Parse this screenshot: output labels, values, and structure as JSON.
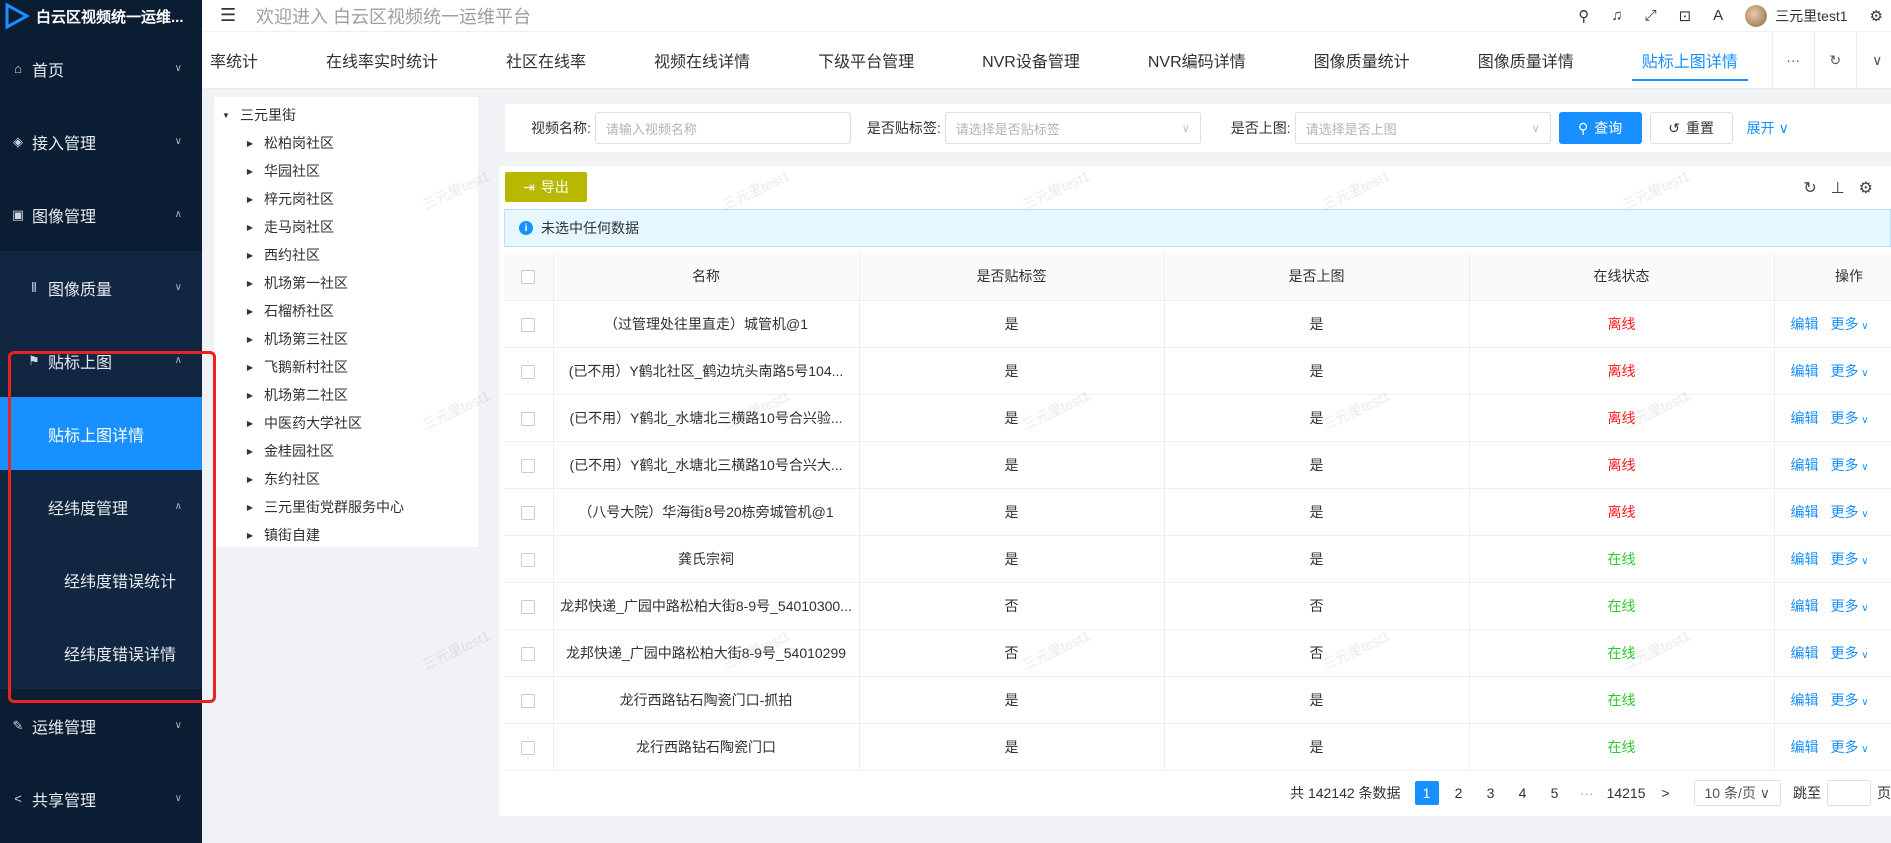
{
  "app": {
    "title": "白云区视频统一运维...",
    "welcome": "欢迎进入 白云区视频统一运维平台",
    "user": "三元里test1",
    "watermark": "三元里test1"
  },
  "sidebar": {
    "items": [
      {
        "label": "首页",
        "icon": "home-icon"
      },
      {
        "label": "接入管理",
        "icon": "shield-icon"
      },
      {
        "label": "图像管理",
        "icon": "image-icon"
      },
      {
        "label": "图像质量",
        "icon": "barcode-icon"
      },
      {
        "label": "贴标上图",
        "icon": "map-pin-icon"
      },
      {
        "label": "贴标上图详情"
      },
      {
        "label": "经纬度管理"
      },
      {
        "label": "经纬度错误统计"
      },
      {
        "label": "经纬度错误详情"
      },
      {
        "label": "运维管理",
        "icon": "wrench-icon"
      },
      {
        "label": "共享管理",
        "icon": "share-icon"
      }
    ]
  },
  "tabs": [
    "率统计",
    "在线率实时统计",
    "社区在线率",
    "视频在线详情",
    "下级平台管理",
    "NVR设备管理",
    "NVR编码详情",
    "图像质量统计",
    "图像质量详情",
    "贴标上图详情"
  ],
  "tab_more": "···",
  "tree": {
    "root": "三元里街",
    "children": [
      "松柏岗社区",
      "华园社区",
      "梓元岗社区",
      "走马岗社区",
      "西约社区",
      "机场第一社区",
      "石榴桥社区",
      "机场第三社区",
      "飞鹅新村社区",
      "机场第二社区",
      "中医药大学社区",
      "金桂园社区",
      "东约社区",
      "三元里街党群服务中心",
      "镇街自建"
    ]
  },
  "search": {
    "name_label": "视频名称:",
    "name_placeholder": "请输入视频名称",
    "tag_label": "是否贴标签:",
    "tag_placeholder": "请选择是否贴标签",
    "map_label": "是否上图:",
    "map_placeholder": "请选择是否上图",
    "query": "查询",
    "reset": "重置",
    "expand": "展开"
  },
  "toolbar": {
    "export": "导出",
    "info": "未选中任何数据"
  },
  "table": {
    "headers": [
      "名称",
      "是否贴标签",
      "是否上图",
      "在线状态",
      "操作"
    ],
    "rows": [
      {
        "name": "（过管理处往里直走）城管机@1",
        "tag": "是",
        "map": "是",
        "status": "离线",
        "online": false
      },
      {
        "name": "(已不用）Y鹤北社区_鹤边坑头南路5号104...",
        "tag": "是",
        "map": "是",
        "status": "离线",
        "online": false
      },
      {
        "name": "(已不用）Y鹤北_水塘北三横路10号合兴验...",
        "tag": "是",
        "map": "是",
        "status": "离线",
        "online": false
      },
      {
        "name": "(已不用）Y鹤北_水塘北三横路10号合兴大...",
        "tag": "是",
        "map": "是",
        "status": "离线",
        "online": false
      },
      {
        "name": "（八号大院）华海街8号20栋旁城管机@1",
        "tag": "是",
        "map": "是",
        "status": "离线",
        "online": false
      },
      {
        "name": "龚氏宗祠",
        "tag": "是",
        "map": "是",
        "status": "在线",
        "online": true
      },
      {
        "name": "龙邦快递_广园中路松柏大街8-9号_54010300...",
        "tag": "否",
        "map": "否",
        "status": "在线",
        "online": true
      },
      {
        "name": "龙邦快递_广园中路松柏大街8-9号_54010299",
        "tag": "否",
        "map": "否",
        "status": "在线",
        "online": true
      },
      {
        "name": "龙行西路钻石陶瓷门口-抓拍",
        "tag": "是",
        "map": "是",
        "status": "在线",
        "online": true
      },
      {
        "name": "龙行西路钻石陶瓷门口",
        "tag": "是",
        "map": "是",
        "status": "在线",
        "online": true
      }
    ],
    "op_edit": "编辑",
    "op_more": "更多"
  },
  "pager": {
    "total": "共 142142 条数据",
    "pages": [
      "1",
      "2",
      "3",
      "4",
      "5"
    ],
    "ellipsis": "···",
    "last": "14215",
    "next": ">",
    "size": "10 条/页",
    "jump": "跳至",
    "page_suffix": "页"
  },
  "colors": {
    "sidebar": "#0b1d32",
    "primary": "#1890ff",
    "export": "#b9b800",
    "offline": "#ff1a1a",
    "online": "#2ec92e",
    "highlight": "#e8221f"
  }
}
